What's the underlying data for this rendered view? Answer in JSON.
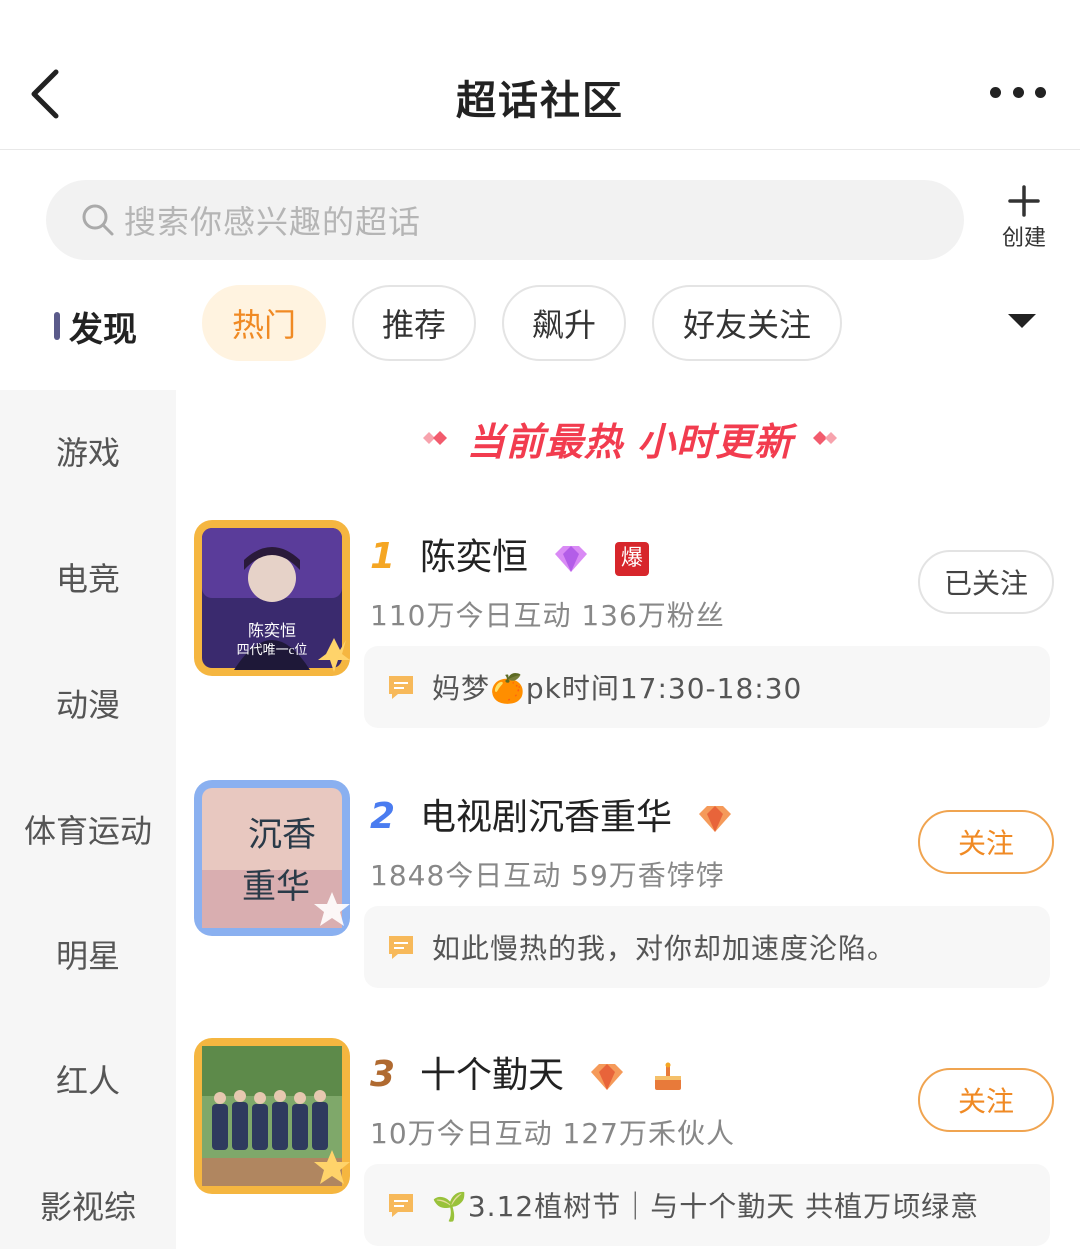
{
  "header": {
    "title": "超话社区"
  },
  "search": {
    "placeholder": "搜索你感兴趣的超话",
    "create_label": "创建"
  },
  "sidebar": {
    "items": [
      "发现",
      "游戏",
      "电竞",
      "动漫",
      "体育运动",
      "明星",
      "红人",
      "影视综"
    ],
    "active_index": 0
  },
  "tabs": {
    "items": [
      "热门",
      "推荐",
      "飙升",
      "好友关注"
    ],
    "active_index": 0
  },
  "banner": {
    "text": "当前最热 小时更新"
  },
  "topics": [
    {
      "rank": "1",
      "name": "陈奕恒",
      "stats": "110万今日互动 136万粉丝",
      "follow_label": "已关注",
      "followed": true,
      "badges": [
        "diamond-level-badge",
        "hot-bao-badge"
      ],
      "hot_badge_text": "爆",
      "post_text": "妈梦🍊pk时间17:30-18:30",
      "thumb_caption_line1": "陈奕恒",
      "thumb_caption_line2": "四代唯一c位"
    },
    {
      "rank": "2",
      "name": "电视剧沉香重华",
      "stats": "1848今日互动 59万香饽饽",
      "follow_label": "关注",
      "followed": false,
      "badges": [
        "diamond-level-badge"
      ],
      "post_text": "如此慢热的我，对你却加速度沦陷。",
      "thumb_caption_line1": "沉香",
      "thumb_caption_line2": "重华"
    },
    {
      "rank": "3",
      "name": "十个勤天",
      "stats": "10万今日互动 127万禾伙人",
      "follow_label": "关注",
      "followed": false,
      "badges": [
        "diamond-level-badge",
        "cake-badge"
      ],
      "post_text": "🌱3.12植树节｜与十个勤天 共植万顷绿意"
    }
  ],
  "colors": {
    "accent_orange": "#f08a24",
    "banner_red": "#f23c4f",
    "rank1": "#f5a623",
    "rank2": "#4a7cf0",
    "rank3": "#b06a30"
  }
}
